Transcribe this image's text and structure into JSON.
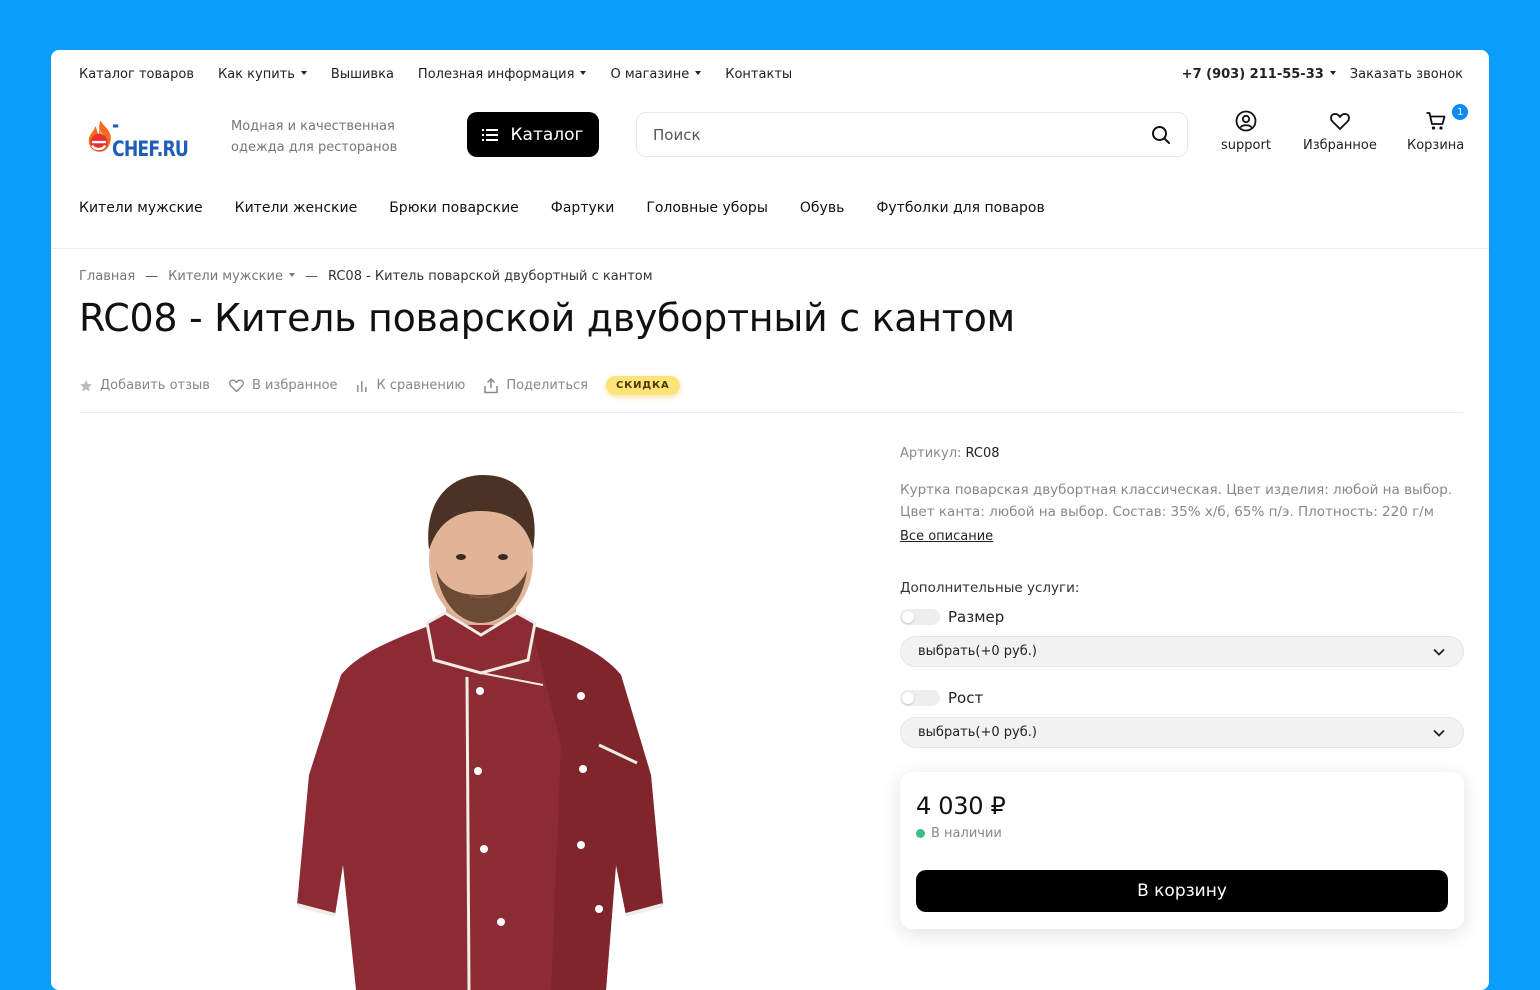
{
  "topnav": {
    "items": [
      {
        "label": "Каталог товаров",
        "caret": false
      },
      {
        "label": "Как купить",
        "caret": true
      },
      {
        "label": "Вышивка",
        "caret": false
      },
      {
        "label": "Полезная информация",
        "caret": true
      },
      {
        "label": "О магазине",
        "caret": true
      },
      {
        "label": "Контакты",
        "caret": false
      }
    ],
    "phone": "+7 (903) 211-55-33",
    "callback": "Заказать звонок"
  },
  "header": {
    "logo_text": "-CHEF.RU",
    "logo_letter": "e",
    "tagline": "Модная и качественная одежда для ресторанов",
    "catalog_label": "Каталог",
    "search_placeholder": "Поиск",
    "support_label": "support",
    "favorites_label": "Избранное",
    "cart_label": "Корзина",
    "cart_count": "1"
  },
  "categories": [
    "Кители мужские",
    "Кители женские",
    "Брюки поварские",
    "Фартуки",
    "Головные уборы",
    "Обувь",
    "Футболки для поваров"
  ],
  "breadcrumb": {
    "home": "Главная",
    "section": "Кители мужские",
    "current": "RC08 - Китель поварской двубортный с кантом"
  },
  "product": {
    "title": "RC08 - Китель поварской двубортный с кантом",
    "actions": {
      "review": "Добавить отзыв",
      "favorite": "В избранное",
      "compare": "К сравнению",
      "share": "Поделиться",
      "badge": "СКИДКА"
    },
    "sku_label": "Артикул:",
    "sku": "RC08",
    "description": "Куртка поварская двубортная классическая. Цвет изделия: любой на выбор. Цвет канта: любой на выбор. Состав: 35% х/б, 65% п/э. Плотность: 220 г/м",
    "more": "Все описание",
    "services_title": "Дополнительные услуги:",
    "options": [
      {
        "label": "Размер",
        "value": "выбрать(+0 руб.)"
      },
      {
        "label": "Рост",
        "value": "выбрать(+0 руб.)"
      }
    ],
    "price": "4 030 ₽",
    "stock": "В наличии",
    "cart_button": "В корзину"
  },
  "colors": {
    "background": "#0a9dfb",
    "accent": "#000000",
    "badge_bg": "#fde37a",
    "stock_dot": "#3cbf86",
    "jacket": "#8c2b33"
  }
}
